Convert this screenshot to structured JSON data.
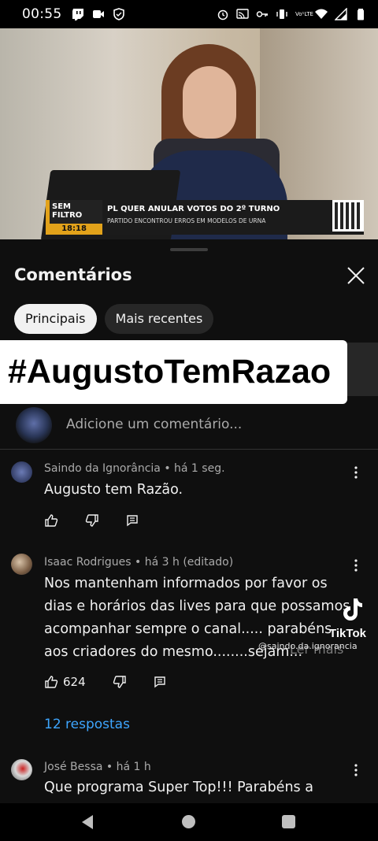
{
  "status_bar": {
    "time": "00:55",
    "left_icons": [
      "twitch-icon",
      "video-camera-icon",
      "shield-icon"
    ],
    "right_icons": [
      "alarm-icon",
      "cast-icon",
      "key-icon",
      "vibrate-icon",
      "volte-icon",
      "wifi-icon",
      "signal-icon",
      "battery-icon"
    ],
    "volte_label": "Vo¹LTE"
  },
  "video": {
    "lower_third": {
      "brand": "SEM FILTRO",
      "clock": "18:18",
      "headline": "PL QUER ANULAR VOTOS DO 2º TURNO",
      "subheadline": "PARTIDO ENCONTROU ERROS EM MODELOS DE URNA"
    }
  },
  "comments_sheet": {
    "title": "Comentários",
    "chips": [
      {
        "label": "Principais",
        "active": true
      },
      {
        "label": "Mais recentes",
        "active": false
      }
    ],
    "overlay_hashtag": "#AugustoTemRazao",
    "add_comment_placeholder": "Adicione um comentário...",
    "comments": [
      {
        "meta": "Saindo da Ignorância • há 1 seg.",
        "text": "Augusto tem Razão.",
        "likes": ""
      },
      {
        "meta": "Isaac Rodrigues • há 3 h (editado)",
        "lines": [
          "Nos mantenham informados por favor os",
          "dias e horários das lives para que possamos",
          "acompanhar sempre o canal..... parabéns",
          "aos criadores do mesmo........sejam..."
        ],
        "read_more": "Ler mais",
        "likes": "624",
        "replies": "12 respostas"
      },
      {
        "meta": "José Bessa • há 1 h",
        "text": "Que programa Super Top!!! Parabéns a"
      }
    ]
  },
  "watermark": {
    "label": "TikTok",
    "handle": "@saindo.da.ignorancia"
  },
  "nav_bar": {
    "icons": [
      "back-triangle-icon",
      "home-circle-icon",
      "recents-square-icon"
    ]
  }
}
